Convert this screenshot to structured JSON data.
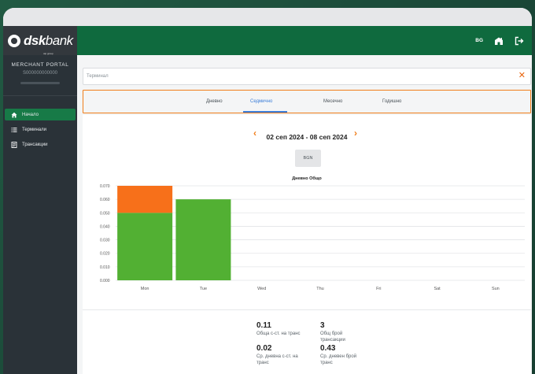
{
  "app": {
    "logo_bold": "dsk",
    "logo_light": "bank",
    "logo_sub": "otp group",
    "portal_title": "MERCHANT PORTAL",
    "merchant_id": "S000000000000",
    "language": "BG"
  },
  "sidebar": {
    "items": [
      {
        "label": "Начало",
        "icon": "home-icon",
        "active": true
      },
      {
        "label": "Терминали",
        "icon": "list-icon",
        "active": false
      },
      {
        "label": "Трансакции",
        "icon": "receipt-icon",
        "active": false
      }
    ]
  },
  "filters": {
    "terminal_placeholder": "Терминал"
  },
  "tabs": [
    {
      "label": "Дневно",
      "active": false
    },
    {
      "label": "Седмично",
      "active": true
    },
    {
      "label": "Месечно",
      "active": false
    },
    {
      "label": "Годишно",
      "active": false
    }
  ],
  "period": {
    "range": "02 сеп 2024 - 08 сеп 2024",
    "currency": "BGN"
  },
  "colors": {
    "brand_green": "#0f6a3e",
    "bar_green": "#52b033",
    "bar_orange": "#f7701a",
    "accent_orange": "#f07d1a",
    "tab_blue": "#3b7dd8"
  },
  "chart_data": {
    "type": "bar",
    "stacked": true,
    "title": "Дневно Общо",
    "categories": [
      "Mon",
      "Tue",
      "Wed",
      "Thu",
      "Fri",
      "Sat",
      "Sun"
    ],
    "series": [
      {
        "color": "#52b033",
        "values": [
          0.05,
          0.06,
          0,
          0,
          0,
          0,
          0
        ]
      },
      {
        "color": "#f7701a",
        "values": [
          0.02,
          0,
          0,
          0,
          0,
          0,
          0
        ]
      }
    ],
    "ylim": [
      0,
      0.07
    ],
    "yticks": [
      "0.000",
      "0.010",
      "0.020",
      "0.030",
      "0.040",
      "0.050",
      "0.060",
      "0.070"
    ],
    "grid": true
  },
  "stats": {
    "total_amount": {
      "value": "0.11",
      "label": "Обща с-ст. на транс"
    },
    "total_count": {
      "value": "3",
      "label": "Общ брой трансакции"
    },
    "avg_daily_amount": {
      "value": "0.02",
      "label": "Ср. дневна с-ст. на транс"
    },
    "avg_daily_count": {
      "value": "0.43",
      "label": "Ср. дневен брой транс"
    }
  }
}
